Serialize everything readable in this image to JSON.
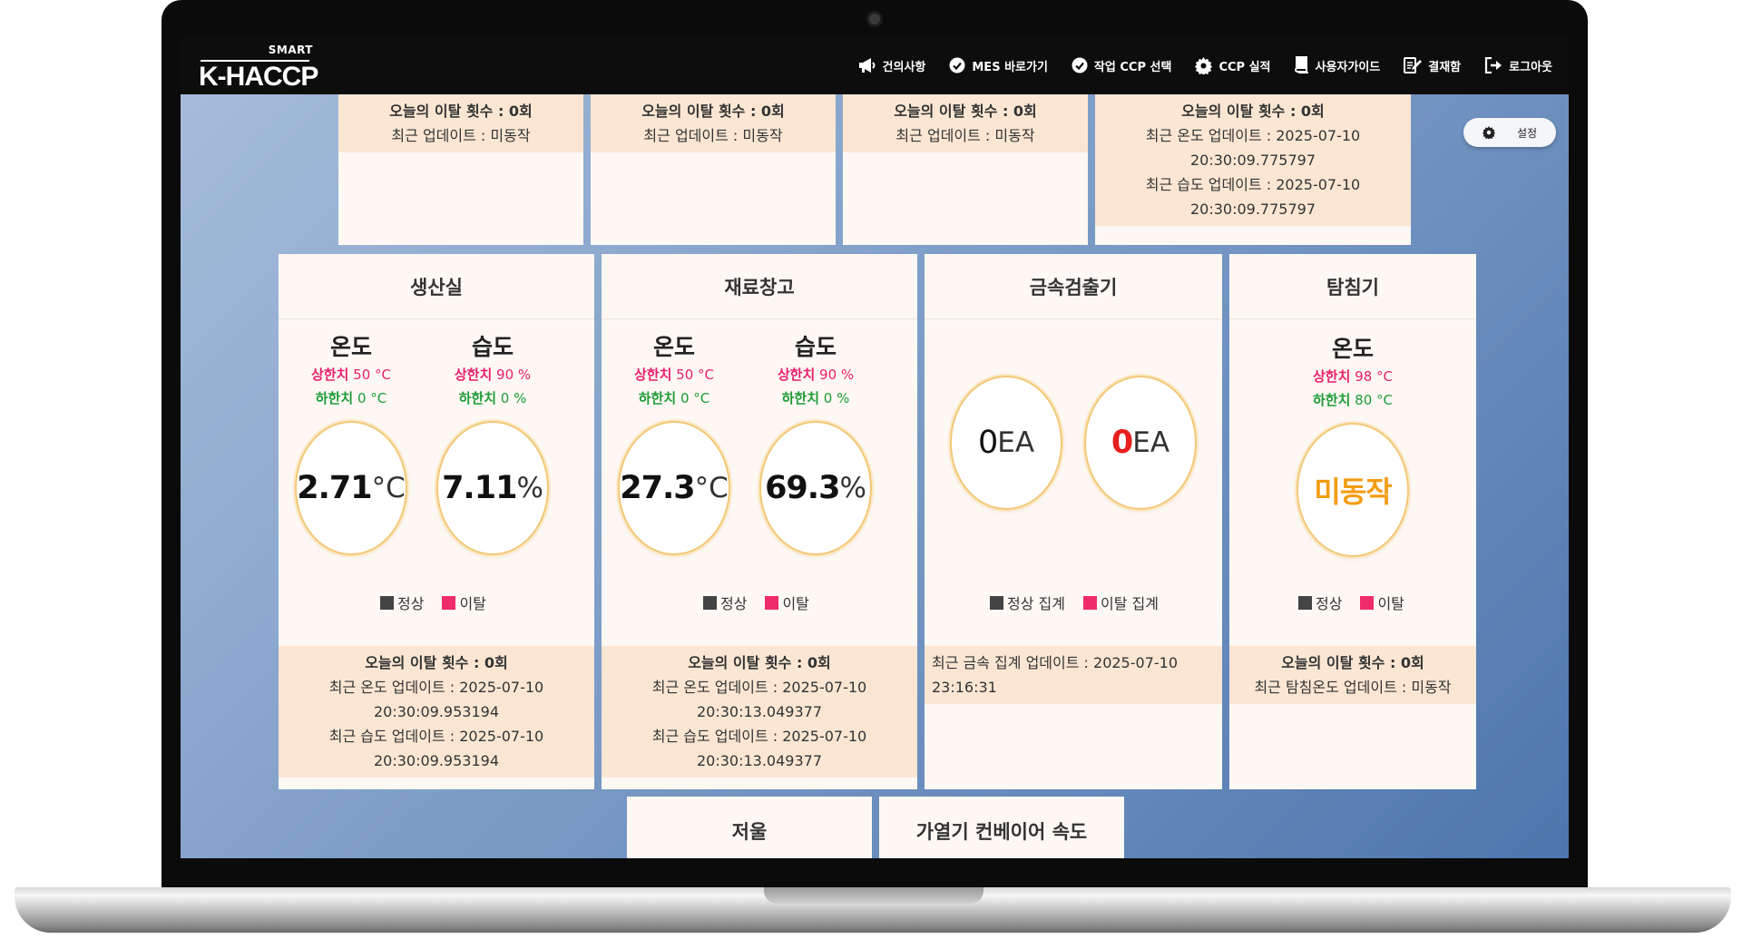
{
  "header": {
    "logo_top": "SMART",
    "logo_main": "K-HACCP",
    "nav": [
      {
        "icon": "megaphone-icon",
        "label": "건의사항"
      },
      {
        "icon": "check-circle-icon",
        "label": "MES 바로가기"
      },
      {
        "icon": "check-circle-icon",
        "label": "작업 CCP 선택"
      },
      {
        "icon": "gear-icon",
        "label": "CCP 실적"
      },
      {
        "icon": "book-icon",
        "label": "사용자가이드"
      },
      {
        "icon": "edit-document-icon",
        "label": "결재함"
      },
      {
        "icon": "logout-icon",
        "label": "로그아웃"
      }
    ]
  },
  "settings": {
    "label": "설정"
  },
  "top_cards": [
    {
      "count_text": "오늘의 이탈 횟수 : 0회",
      "lines": [
        "최근 업데이트 : 미동작"
      ]
    },
    {
      "count_text": "오늘의 이탈 횟수 : 0회",
      "lines": [
        "최근 업데이트 : 미동작"
      ]
    },
    {
      "count_text": "오늘의 이탈 횟수 : 0회",
      "lines": [
        "최근 업데이트 : 미동작"
      ]
    },
    {
      "count_text": "오늘의 이탈 횟수 : 0회",
      "lines": [
        "최근 온도 업데이트 : 2025-07-10 20:30:09.775797",
        "최근 습도 업데이트 : 2025-07-10 20:30:09.775797"
      ]
    }
  ],
  "production": {
    "title": "생산실",
    "temp": {
      "label": "온도",
      "upper_label": "상한치",
      "upper_value": "50 °C",
      "lower_label": "하한치",
      "lower_value": "0 °C",
      "value": "2.71",
      "unit": "°C"
    },
    "humid": {
      "label": "습도",
      "upper_label": "상한치",
      "upper_value": "90 %",
      "lower_label": "하한치",
      "lower_value": "0 %",
      "value": "7.11",
      "unit": "%"
    },
    "legend_normal": "정상",
    "legend_deviation": "이탈",
    "count_text": "오늘의 이탈 횟수 : 0회",
    "lines": [
      "최근 온도 업데이트 : 2025-07-10 20:30:09.953194",
      "최근 습도 업데이트 : 2025-07-10 20:30:09.953194"
    ]
  },
  "storage": {
    "title": "재료창고",
    "temp": {
      "label": "온도",
      "upper_label": "상한치",
      "upper_value": "50 °C",
      "lower_label": "하한치",
      "lower_value": "0 °C",
      "value": "27.3",
      "unit": "°C"
    },
    "humid": {
      "label": "습도",
      "upper_label": "상한치",
      "upper_value": "90 %",
      "lower_label": "하한치",
      "lower_value": "0 %",
      "value": "69.3",
      "unit": "%"
    },
    "legend_normal": "정상",
    "legend_deviation": "이탈",
    "count_text": "오늘의 이탈 횟수 : 0회",
    "lines": [
      "최근 온도 업데이트 : 2025-07-10 20:30:13.049377",
      "최근 습도 업데이트 : 2025-07-10 20:30:13.049377"
    ]
  },
  "metal": {
    "title": "금속검출기",
    "normal_count": "0",
    "normal_unit": "EA",
    "deviation_count": "0",
    "deviation_unit": "EA",
    "legend_normal": "정상 집계",
    "legend_deviation": "이탈 집계",
    "update_text": "최근 금속 집계 업데이트 : 2025-07-10 23:16:31"
  },
  "probe": {
    "title": "탐침기",
    "temp": {
      "label": "온도",
      "upper_label": "상한치",
      "upper_value": "98 °C",
      "lower_label": "하한치",
      "lower_value": "80 °C",
      "value": "미동작"
    },
    "legend_normal": "정상",
    "legend_deviation": "이탈",
    "count_text": "오늘의 이탈 횟수 : 0회",
    "lines": [
      "최근 탐침온도 업데이트 : 미동작"
    ]
  },
  "bottom_cards": [
    {
      "title": "저울"
    },
    {
      "title": "가열기 컨베이어 속도"
    }
  ],
  "colors": {
    "upper": "#e81f6b",
    "lower": "#1f9b37",
    "status_off": "#f39c12",
    "deviation": "#ef2c6b",
    "normal": "#444444"
  }
}
